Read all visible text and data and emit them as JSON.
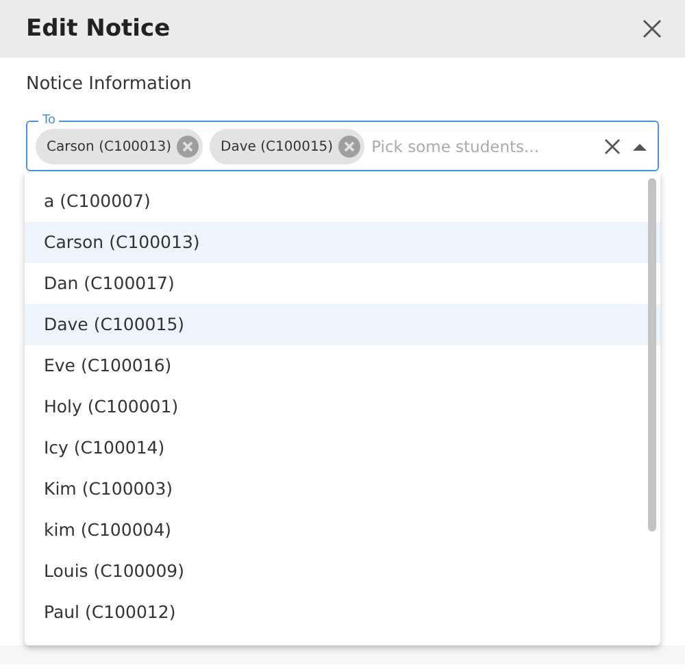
{
  "dialog": {
    "title": "Edit Notice"
  },
  "section": {
    "title": "Notice Information"
  },
  "field": {
    "label": "To",
    "placeholder": "Pick some students...",
    "chips": [
      {
        "label": "Carson (C100013)"
      },
      {
        "label": "Dave (C100015)"
      }
    ]
  },
  "options": [
    {
      "label": "a (C100007)",
      "selected": false
    },
    {
      "label": "Carson (C100013)",
      "selected": true
    },
    {
      "label": "Dan (C100017)",
      "selected": false
    },
    {
      "label": "Dave (C100015)",
      "selected": true
    },
    {
      "label": "Eve (C100016)",
      "selected": false
    },
    {
      "label": "Holy (C100001)",
      "selected": false
    },
    {
      "label": "Icy (C100014)",
      "selected": false
    },
    {
      "label": "Kim (C100003)",
      "selected": false
    },
    {
      "label": "kim (C100004)",
      "selected": false
    },
    {
      "label": "Louis (C100009)",
      "selected": false
    },
    {
      "label": "Paul (C100012)",
      "selected": false
    }
  ]
}
